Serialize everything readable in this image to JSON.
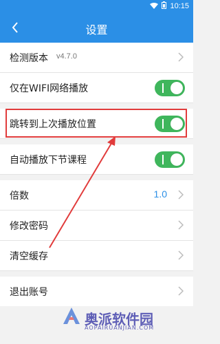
{
  "status": {
    "time": "10:15"
  },
  "app_bar": {
    "title": "设置"
  },
  "rows": [
    {
      "label": "检测版本",
      "sub": "v4.7.0"
    },
    {
      "label": "仅在WIFI网络播放"
    },
    {
      "label": "跳转到上次播放位置"
    },
    {
      "label": "自动播放下节课程"
    },
    {
      "label": "倍数",
      "value": "1.0"
    },
    {
      "label": "修改密码"
    },
    {
      "label": "清空缓存"
    },
    {
      "label": "退出账号"
    }
  ],
  "toggles": {
    "wifi_only": true,
    "jump_to_last": true,
    "autoplay_next": true
  },
  "watermark": {
    "text": "奥派软件园",
    "url": "AOPAIRUANJIAN.COM"
  },
  "colors": {
    "brand": "#2b8fe6",
    "toggle_on": "#3fb65c",
    "highlight": "#e13b3b"
  }
}
